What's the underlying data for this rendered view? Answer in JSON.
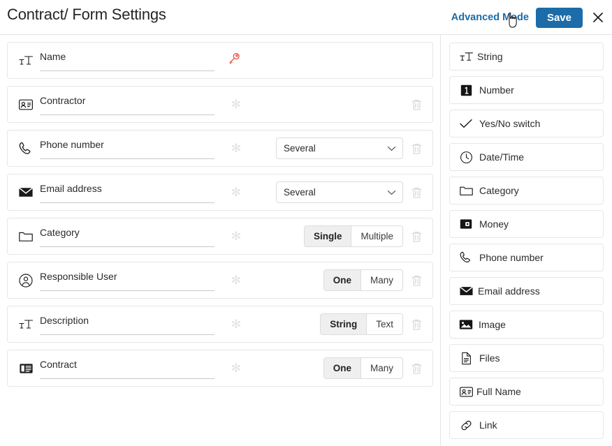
{
  "header": {
    "title": "Contract/ Form Settings",
    "advanced_mode_label": "Advanced Mode",
    "save_label": "Save",
    "close_icon": "close-icon",
    "accent_color": "#1b6ca8"
  },
  "form_fields": [
    {
      "icon": "text-string-icon",
      "name": "Name",
      "required_marker": "",
      "has_key": true,
      "key_icon": "key-icon",
      "key_color": "#e8534f",
      "control": "none",
      "deletable": false
    },
    {
      "icon": "contact-card-icon",
      "name": "Contractor",
      "required_marker": "✻",
      "has_key": false,
      "control": "none",
      "deletable": true
    },
    {
      "icon": "phone-icon",
      "name": "Phone number",
      "required_marker": "✻",
      "has_key": false,
      "control": "select",
      "select_value": "Several",
      "select_options": [
        "Several"
      ],
      "deletable": true
    },
    {
      "icon": "email-icon",
      "name": "Email address",
      "required_marker": "✻",
      "has_key": false,
      "control": "select",
      "select_value": "Several",
      "select_options": [
        "Several"
      ],
      "deletable": true
    },
    {
      "icon": "folder-icon",
      "name": "Category",
      "required_marker": "✻",
      "has_key": false,
      "control": "segmented",
      "segments": [
        "Single",
        "Multiple"
      ],
      "selected_segment": "Single",
      "deletable": true
    },
    {
      "icon": "user-circle-icon",
      "name": "Responsible User",
      "required_marker": "✻",
      "has_key": false,
      "control": "segmented",
      "segments": [
        "One",
        "Many"
      ],
      "selected_segment": "One",
      "deletable": true
    },
    {
      "icon": "text-string-icon",
      "name": "Description",
      "required_marker": "✻",
      "has_key": false,
      "control": "segmented",
      "segments": [
        "String",
        "Text"
      ],
      "selected_segment": "String",
      "deletable": true
    },
    {
      "icon": "article-icon",
      "name": "Contract",
      "required_marker": "✻",
      "has_key": false,
      "control": "segmented",
      "segments": [
        "One",
        "Many"
      ],
      "selected_segment": "One",
      "deletable": true
    }
  ],
  "field_types": [
    {
      "icon": "text-string-icon",
      "label": "String"
    },
    {
      "icon": "number-icon",
      "label": "Number"
    },
    {
      "icon": "check-icon",
      "label": "Yes/No switch"
    },
    {
      "icon": "clock-icon",
      "label": "Date/Time"
    },
    {
      "icon": "folder-icon",
      "label": "Category"
    },
    {
      "icon": "money-icon",
      "label": "Money"
    },
    {
      "icon": "phone-icon",
      "label": "Phone number"
    },
    {
      "icon": "email-icon",
      "label": "Email address"
    },
    {
      "icon": "image-icon",
      "label": "Image"
    },
    {
      "icon": "file-icon",
      "label": "Files"
    },
    {
      "icon": "contact-card-icon",
      "label": "Full Name"
    },
    {
      "icon": "link-icon",
      "label": "Link"
    }
  ]
}
